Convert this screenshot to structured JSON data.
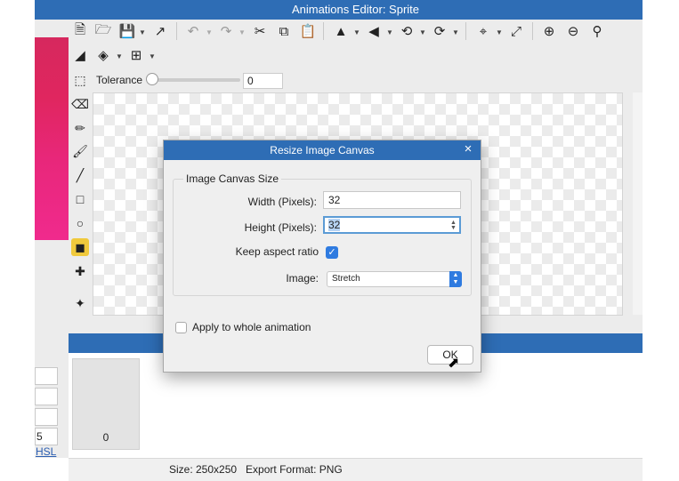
{
  "window": {
    "title": "Animations Editor: Sprite"
  },
  "toolbar": {
    "row1": [
      "new-file-icon",
      "open-folder-icon",
      "save-icon",
      "export-icon",
      "undo-icon",
      "redo-icon",
      "cut-icon",
      "copy-icon",
      "paste-icon",
      "flip-horizontal-icon",
      "flip-vertical-icon",
      "rotate-left-icon",
      "rotate-right-icon",
      "crop-icon",
      "resize-icon",
      "zoom-in-icon",
      "zoom-out-icon",
      "zoom-fit-icon"
    ],
    "row2": [
      "invert-icon",
      "layers-icon",
      "grid-icon"
    ]
  },
  "tolerance": {
    "label": "Tolerance",
    "value": "0",
    "level": 0
  },
  "tools": [
    "select-icon",
    "eraser-icon",
    "pencil-icon",
    "brush-icon",
    "line-icon",
    "rectangle-icon",
    "ellipse-icon",
    "fill-icon",
    "eyedropper-icon",
    "transform-icon"
  ],
  "left_panel": {
    "field4_value": "5",
    "link": "HSL"
  },
  "frames": [
    {
      "number": "0"
    }
  ],
  "status": {
    "text": "Size: 250x250   Export Format: PNG"
  },
  "dialog": {
    "title": "Resize Image Canvas",
    "close": "×",
    "group_label": "Image Canvas Size",
    "width_label": "Width (Pixels):",
    "width_value": "32",
    "height_label": "Height (Pixels):",
    "height_value": "32",
    "aspect_label": "Keep aspect ratio",
    "aspect_checked": true,
    "image_label": "Image:",
    "image_value": "Stretch",
    "apply_label": "Apply to whole animation",
    "apply_checked": false,
    "ok_label": "OK"
  },
  "colors": {
    "titlebar": "#2e6db5",
    "accent": "#2f7be0",
    "active_tool": "#f0c93c"
  }
}
